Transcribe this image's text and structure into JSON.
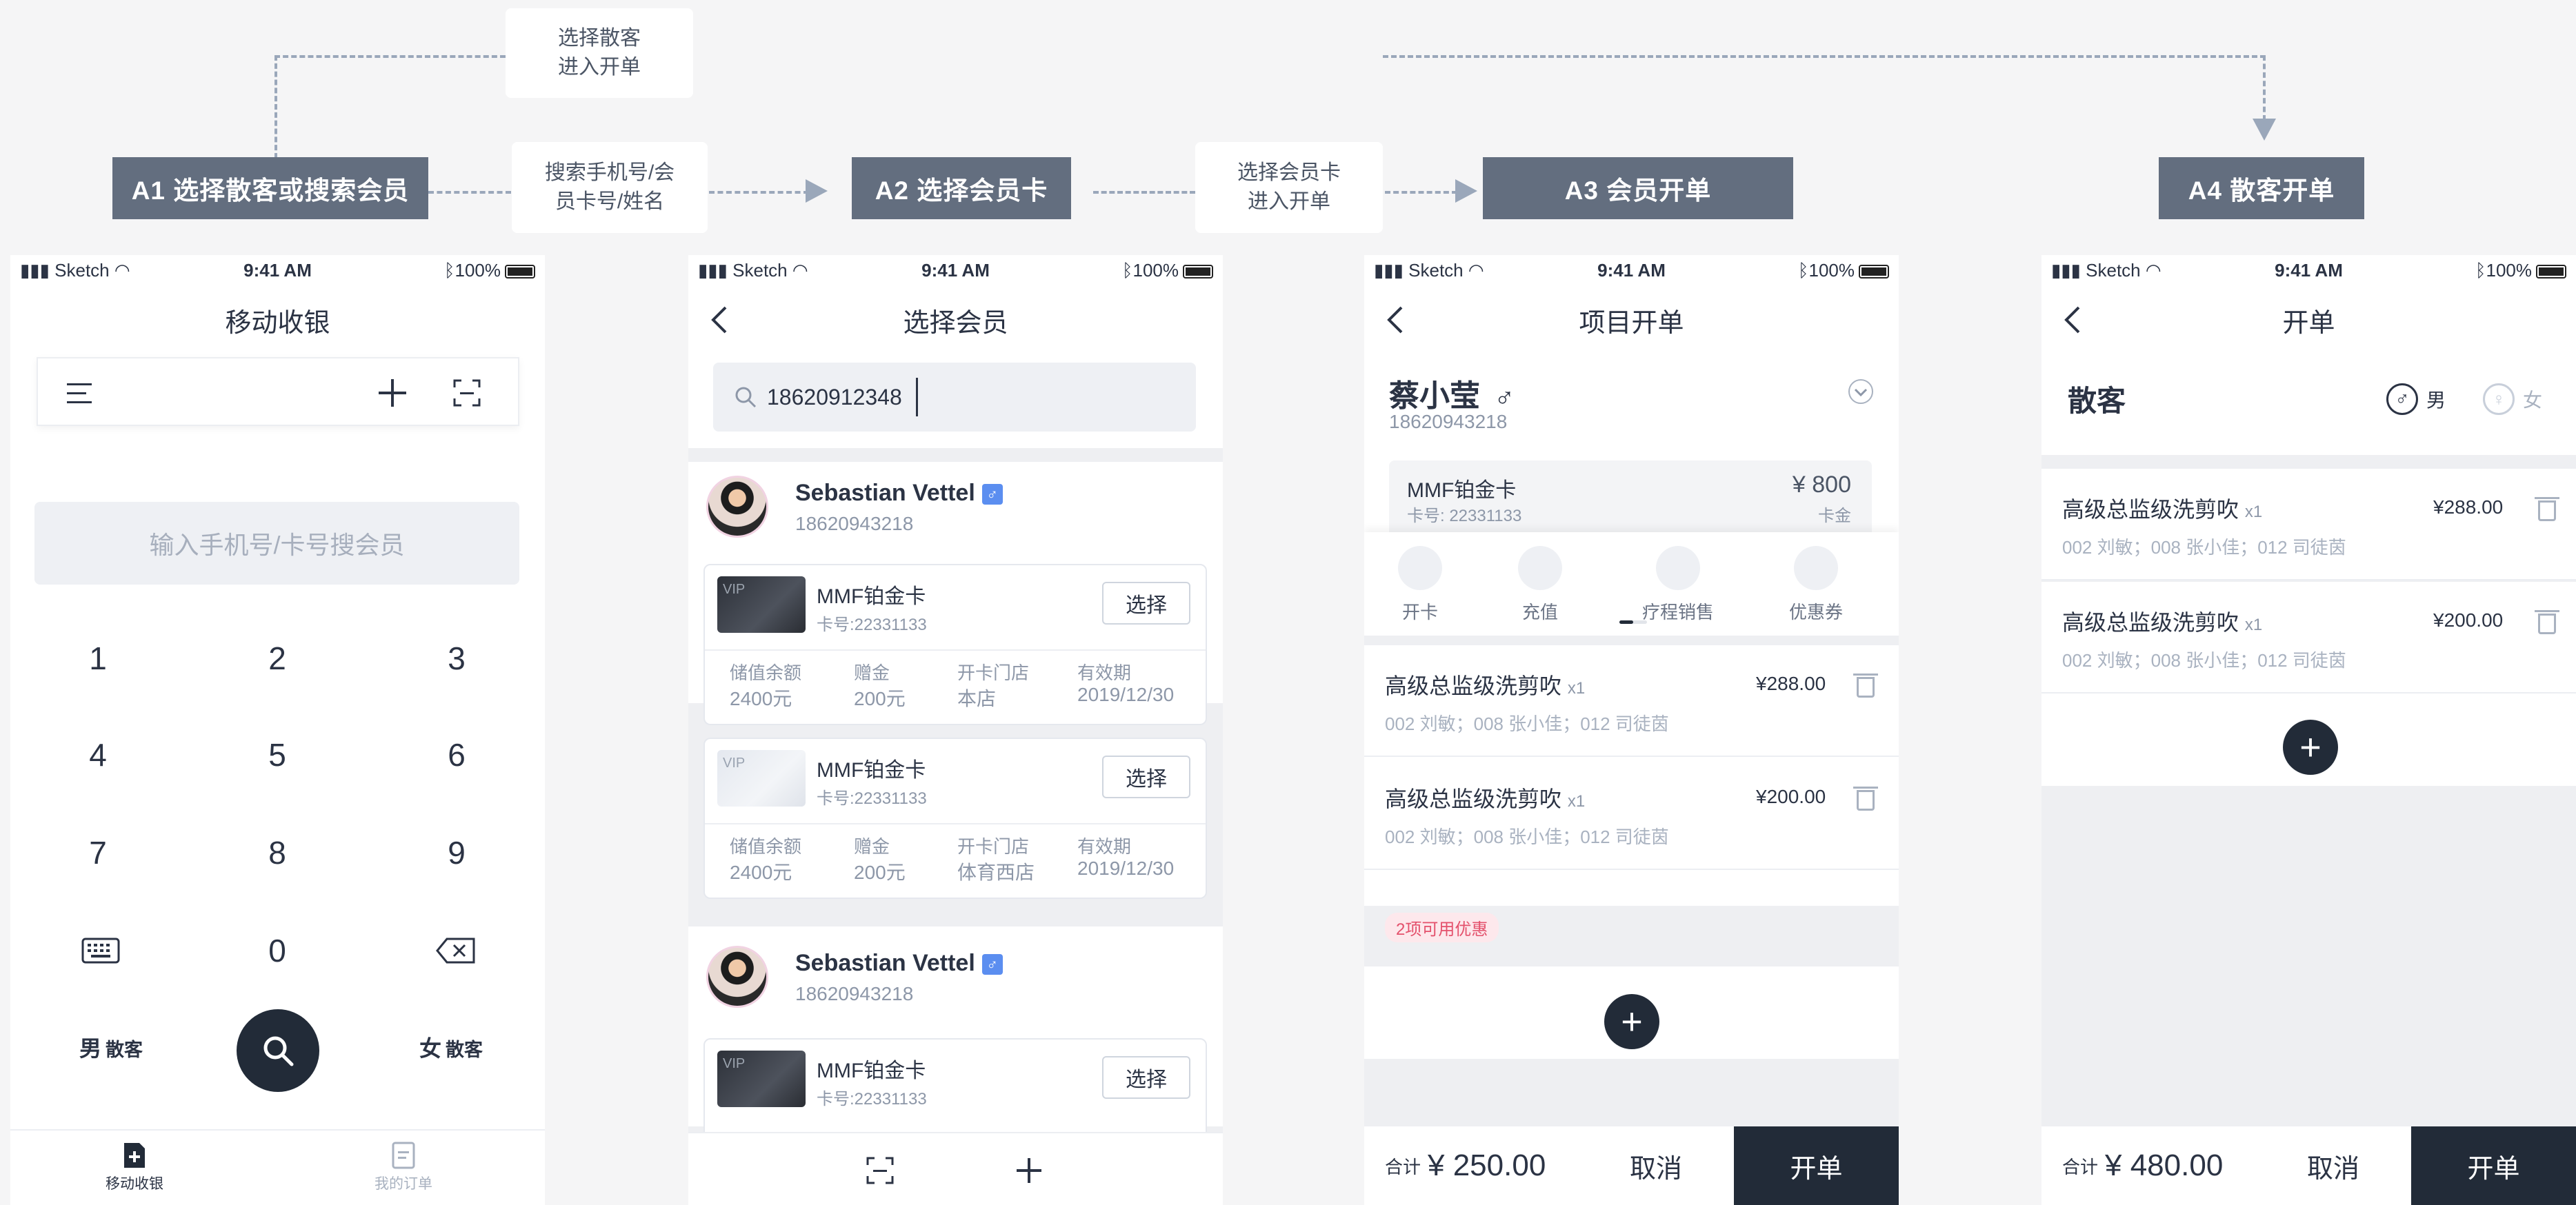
{
  "flow": {
    "stage_a1": "A1 选择散客或搜索会员",
    "stage_a2": "A2 选择会员卡",
    "stage_a3": "A3 会员开单",
    "stage_a4": "A4 散客开单",
    "note_top_line1": "选择散客",
    "note_top_line2": "进入开单",
    "note_search_line1": "搜索手机号/会",
    "note_search_line2": "员卡号/姓名",
    "note_card_line1": "选择会员卡",
    "note_card_line2": "进入开单"
  },
  "status": {
    "carrier": "Sketch",
    "time": "9:41 AM",
    "battery": "100%"
  },
  "screen1": {
    "title": "移动收银",
    "search_placeholder": "输入手机号/卡号搜会员",
    "keys": [
      "1",
      "2",
      "3",
      "4",
      "5",
      "6",
      "7",
      "8",
      "9",
      "0"
    ],
    "male_label": "男",
    "female_label": "女",
    "walkin_label": "散客",
    "tab_checkout": "移动收银",
    "tab_orders": "我的订单"
  },
  "screen2": {
    "title": "选择会员",
    "search_value": "18620912348",
    "member_name": "Sebastian Vettel",
    "member_phone": "18620943218",
    "card_name": "MMF铂金卡",
    "card_no": "卡号:22331133",
    "vip": "VIP",
    "select_label": "选择",
    "col_balance": "储值余额",
    "col_gift": "赠金",
    "col_store": "开卡门店",
    "col_expire": "有效期",
    "balance": "2400元",
    "gift": "200元",
    "store1": "本店",
    "store2": "体育西店",
    "expire": "2019/12/30"
  },
  "screen3": {
    "title": "项目开单",
    "member_name": "蔡小莹",
    "gender_symbol": "♂",
    "member_phone": "18620943218",
    "card_name": "MMF铂金卡",
    "card_no": "卡号: 22331133",
    "card_amount": "¥ 800",
    "card_amount_label": "卡金",
    "actions": [
      "开卡",
      "充值",
      "疗程销售",
      "优惠券"
    ],
    "item_name": "高级总监级洗剪吹",
    "item_qty": "x1",
    "item_staff": "002 刘敏；008 张小佳；012 司徒茵",
    "item1_price": "¥288.00",
    "item2_price": "¥200.00",
    "promo": "2项可用优惠",
    "total_label": "合计",
    "total": "¥ 250.00",
    "cancel": "取消",
    "submit": "开单"
  },
  "screen4": {
    "title": "开单",
    "customer": "散客",
    "male": "男",
    "female": "女",
    "item_name": "高级总监级洗剪吹",
    "item_qty": "x1",
    "item_staff": "002 刘敏；008 张小佳；012 司徒茵",
    "item1_price": "¥288.00",
    "item2_price": "¥200.00",
    "total_label": "合计",
    "total": "¥ 480.00",
    "cancel": "取消",
    "submit": "开单"
  }
}
